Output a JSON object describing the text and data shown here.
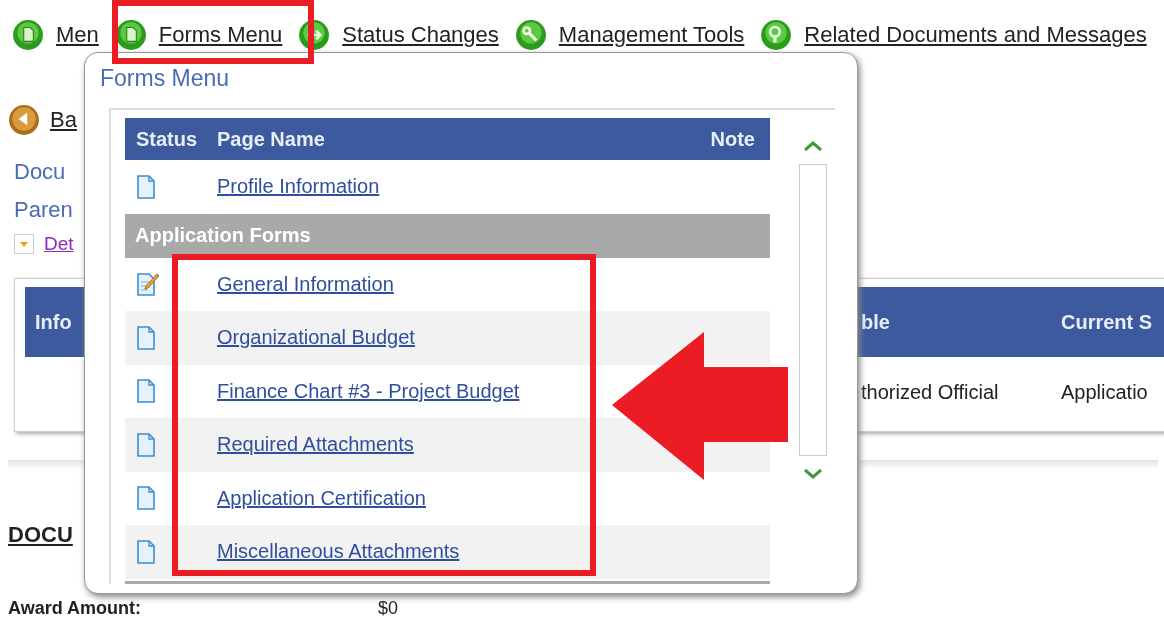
{
  "nav": [
    {
      "label": "Men",
      "kind": "document"
    },
    {
      "label": "Forms Menu",
      "kind": "document"
    },
    {
      "label": "Status Changes",
      "kind": "arrows"
    },
    {
      "label": "Management Tools",
      "kind": "tools"
    },
    {
      "label": "Related Documents and Messages",
      "kind": "search"
    }
  ],
  "back_link": "Ba",
  "document_label": "Docu",
  "parent_label": "Paren",
  "details_link": "Det",
  "table": {
    "columns": [
      "Info",
      "ble",
      "Current S"
    ],
    "rows": [
      [
        "",
        "thorized Official",
        "Applicatio"
      ]
    ]
  },
  "section_heading": "DOCU",
  "award": {
    "label": "Award Amount:",
    "value": "$0"
  },
  "popup": {
    "title": "Forms Menu",
    "columns": [
      "Status",
      "Page Name",
      "Note"
    ],
    "rows": [
      {
        "kind": "page",
        "label": "Profile Information"
      },
      {
        "kind": "group",
        "label": "Application Forms"
      },
      {
        "kind": "edit",
        "label": "General Information"
      },
      {
        "kind": "page",
        "label": "Organizational Budget"
      },
      {
        "kind": "page",
        "label": "Finance Chart #3 - Project Budget"
      },
      {
        "kind": "page",
        "label": "Required Attachments"
      },
      {
        "kind": "page",
        "label": "Application Certification"
      },
      {
        "kind": "page",
        "label": "Miscellaneous Attachments"
      }
    ]
  }
}
